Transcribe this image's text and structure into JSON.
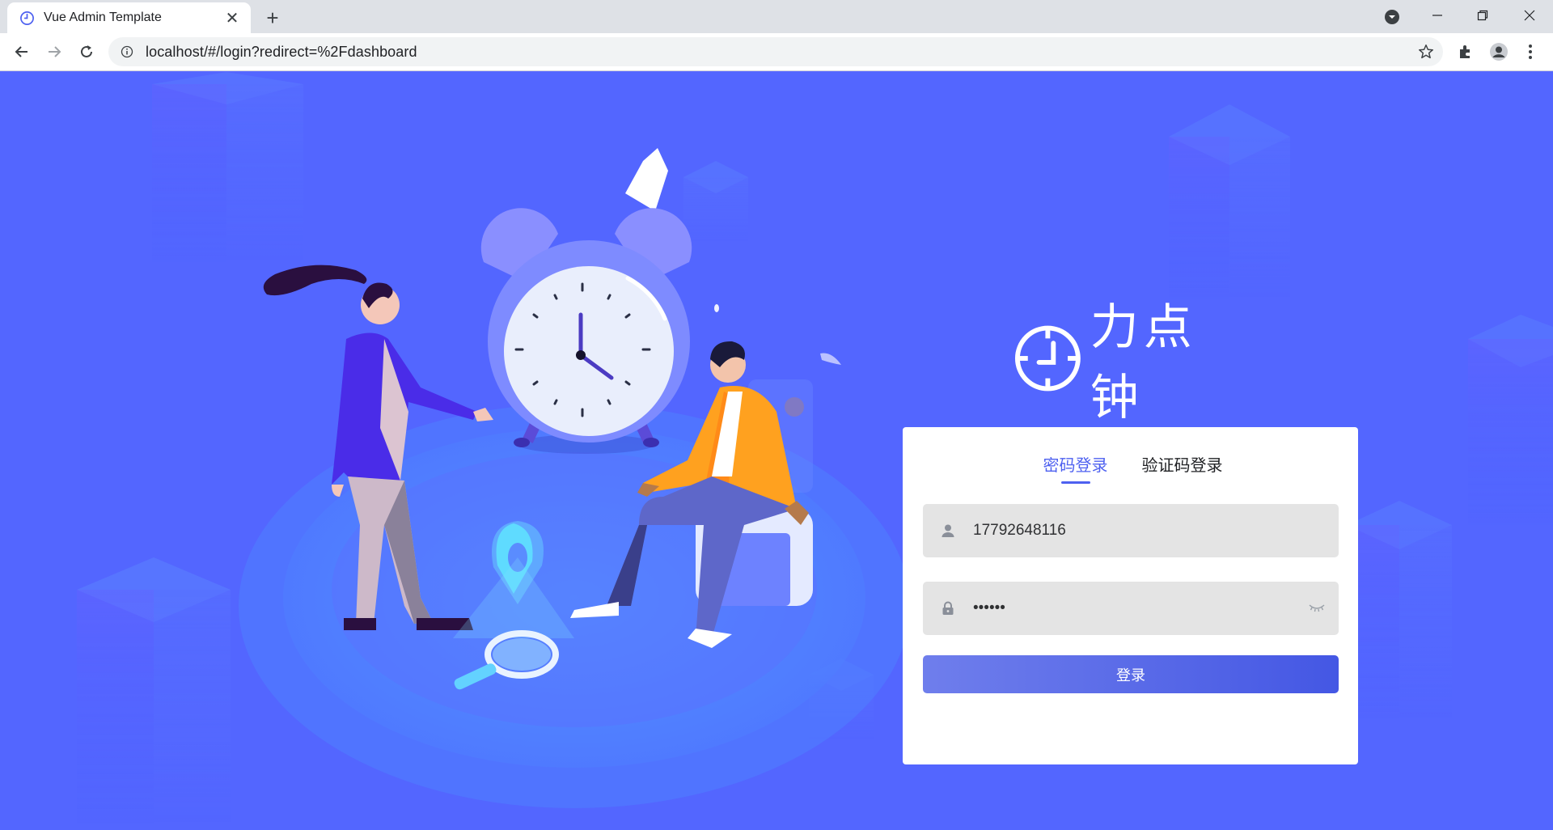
{
  "browser": {
    "tab_title": "Vue Admin Template",
    "tab_close": "✕",
    "new_tab": "+",
    "url": "localhost/#/login?redirect=%2Fdashboard"
  },
  "brand": {
    "name": "力点钟"
  },
  "login": {
    "tabs": [
      {
        "label": "密码登录",
        "active": true
      },
      {
        "label": "验证码登录",
        "active": false
      }
    ],
    "phone_value": "17792648116",
    "password_value": "••••••",
    "submit_label": "登录"
  },
  "colors": {
    "page_bg": "#5366ff",
    "accent": "#4e61f0",
    "field_bg": "#e4e4e4"
  }
}
